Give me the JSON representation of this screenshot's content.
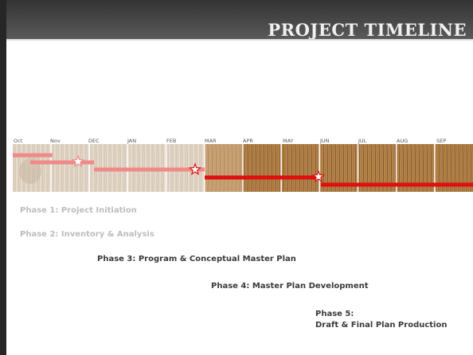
{
  "slide": {
    "title": "PROJECT TIMELINE"
  },
  "months": [
    "Oct",
    "Nov",
    "DEC",
    "JAN",
    "FEB",
    "MAR",
    "APR",
    "MAY",
    "JUN",
    "JUL",
    "AUG",
    "SEP"
  ],
  "phases": [
    {
      "label": "Phase 1: Project Initiation",
      "style": "faded"
    },
    {
      "label": "Phase 2: Inventory & Analysis",
      "style": "faded"
    },
    {
      "label": "Phase 3: Program & Conceptual Master Plan",
      "style": "dark"
    },
    {
      "label": "Phase 4: Master Plan Development",
      "style": "dark"
    },
    {
      "label_line1": "Phase 5:",
      "label_line2": "Draft & Final Plan Production",
      "style": "dark"
    }
  ],
  "colors": {
    "bar_faded": "#f08a8a",
    "bar_active": "#e01010",
    "star": "#ffffff",
    "star_outline": "#e01010",
    "title_bar": "#3f3f3f",
    "title_text": "#f0f0f0"
  },
  "icons": {
    "milestone": "star-icon"
  }
}
